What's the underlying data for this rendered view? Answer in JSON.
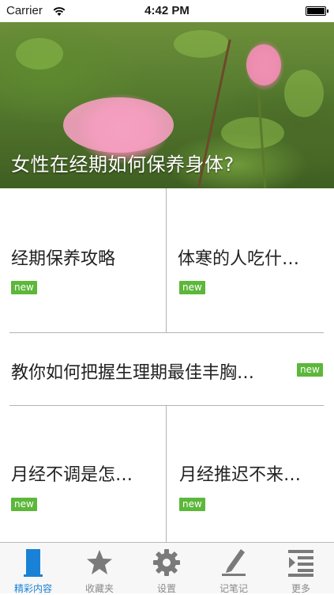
{
  "status_bar": {
    "carrier": "Carrier",
    "time": "4:42 PM"
  },
  "hero": {
    "title": "女性在经期如何保养身体?"
  },
  "articles": [
    {
      "title": "经期保养攻略",
      "badge": "new"
    },
    {
      "title": "体寒的人吃什…",
      "badge": "new"
    },
    {
      "title": "教你如何把握生理期最佳丰胸…",
      "badge": "new"
    },
    {
      "title": "月经不调是怎…",
      "badge": "new"
    },
    {
      "title": "月经推迟不来…",
      "badge": "new"
    }
  ],
  "tabs": [
    {
      "label": "精彩内容",
      "icon": "bookmark-icon",
      "active": true
    },
    {
      "label": "收藏夹",
      "icon": "star-icon",
      "active": false
    },
    {
      "label": "设置",
      "icon": "gear-icon",
      "active": false
    },
    {
      "label": "记笔记",
      "icon": "pen-icon",
      "active": false
    },
    {
      "label": "更多",
      "icon": "list-icon",
      "active": false
    }
  ],
  "colors": {
    "accent": "#1a82d6",
    "badge": "#5cb73a",
    "divider": "#b3b3b3"
  }
}
